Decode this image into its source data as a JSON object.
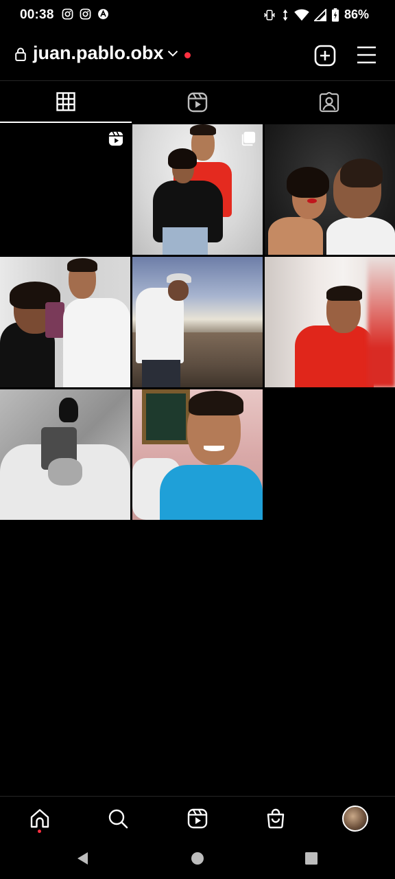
{
  "status_bar": {
    "time": "00:38",
    "battery": "86%",
    "left_icons": [
      "instagram-icon",
      "instagram-icon",
      "app-icon"
    ],
    "right_icons": [
      "vibrate-icon",
      "data-arrows-icon",
      "wifi-icon",
      "signal-icon",
      "battery-icon"
    ]
  },
  "header": {
    "username": "juan.pablo.obx",
    "icons": [
      "lock-icon",
      "chevron-down-icon",
      "notification-dot",
      "add-post-icon",
      "menu-icon"
    ]
  },
  "tabs": [
    {
      "name": "posts-grid",
      "icon": "grid-icon",
      "active": true
    },
    {
      "name": "reels",
      "icon": "reels-icon",
      "active": false
    },
    {
      "name": "tagged",
      "icon": "tagged-icon",
      "active": false
    }
  ],
  "grid": {
    "posts": [
      {
        "kind": "reel",
        "badge": "reels-icon"
      },
      {
        "kind": "carousel",
        "badge": "carousel-icon"
      },
      {
        "kind": "photo"
      },
      {
        "kind": "photo"
      },
      {
        "kind": "photo"
      },
      {
        "kind": "photo"
      },
      {
        "kind": "photo"
      },
      {
        "kind": "photo"
      }
    ]
  },
  "bottom_nav": {
    "items": [
      "home-icon",
      "search-icon",
      "reels-icon",
      "shop-icon",
      "profile-avatar"
    ]
  },
  "system_nav": [
    "back-icon",
    "home-circle-icon",
    "recents-icon"
  ],
  "colors": {
    "background": "#000000",
    "text": "#ffffff",
    "accent_red": "#ff3040",
    "divider": "#262626"
  }
}
